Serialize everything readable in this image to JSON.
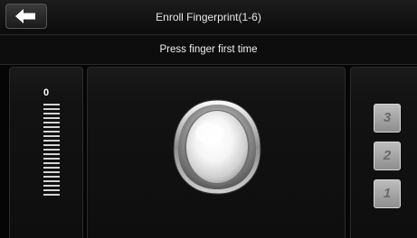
{
  "header": {
    "title": "Enroll Fingerprint(1-6)",
    "back_icon": "back-arrow-icon"
  },
  "prompt": {
    "text": "Press finger first time"
  },
  "quality": {
    "value": "0",
    "total_bars": 21,
    "filled_bars": 0
  },
  "reader": {
    "icon": "fingerprint-sensor-icon"
  },
  "steps": [
    {
      "label": "3",
      "done": false
    },
    {
      "label": "2",
      "done": false
    },
    {
      "label": "1",
      "done": false
    }
  ],
  "colors": {
    "background": "#050505",
    "text": "#f0f0f0",
    "bar": "#d4d4d4",
    "badge": "#a8a8a8"
  }
}
